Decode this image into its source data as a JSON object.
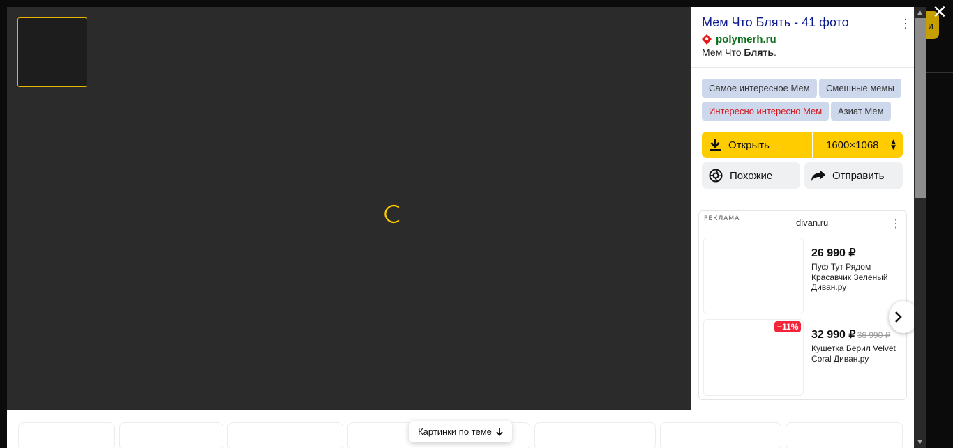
{
  "panel": {
    "title": "Мем Что Блять - 41 фото",
    "source": "polymerh.ru",
    "desc_prefix": "Мем Что ",
    "desc_bold": "Блять",
    "desc_suffix": ".",
    "tags": [
      "Самое интересное Мем",
      "Смешные мемы",
      "Интересно интересно Мем",
      "Азиат Мем"
    ],
    "open_label": "Открыть",
    "size_label": "1600×1068",
    "similar_label": "Похожие",
    "share_label": "Отправить"
  },
  "ad": {
    "label": "РЕКЛАМА",
    "domain": "divan.ru",
    "items": [
      {
        "price": "26 990 ₽",
        "old_price": "",
        "name": "Пуф Тут Рядом Красавчик Зеленый Диван.ру"
      },
      {
        "price": "32 990 ₽",
        "old_price": "36 990 ₽",
        "discount": "−11%",
        "name": "Кушетка Берил Velvet Coral Диван.ру"
      }
    ]
  },
  "bottom": {
    "related_label": "Картинки по теме"
  },
  "background": {
    "button_fragment": "и"
  },
  "colors": {
    "accent": "#ffcc00",
    "title": "#0b1a8f",
    "source": "#0d6f1c",
    "discount": "#f3253a"
  },
  "icons": [
    "close-icon",
    "download-icon",
    "camera-lens-icon",
    "share-icon",
    "kebab-menu-icon",
    "chevron-right-icon",
    "arrow-down-icon",
    "location-pin-icon",
    "spinner-icon"
  ]
}
